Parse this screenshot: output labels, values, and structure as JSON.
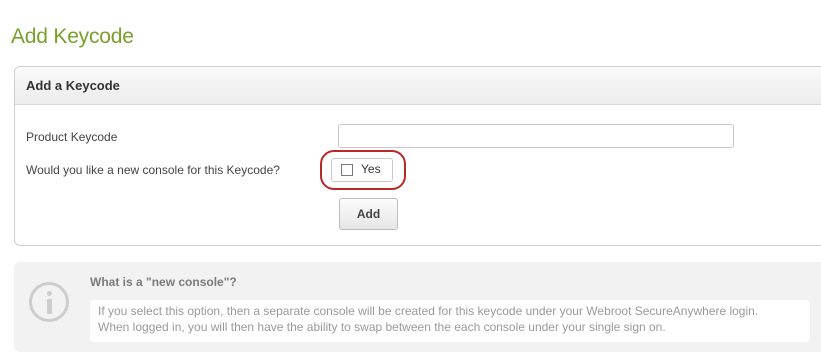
{
  "page": {
    "title": "Add Keycode"
  },
  "panel": {
    "header": "Add a Keycode",
    "product_keycode_label": "Product Keycode",
    "product_keycode_value": "",
    "new_console_question": "Would you like a new console for this Keycode?",
    "new_console_checkbox_label": "Yes",
    "new_console_checked": false,
    "add_button_label": "Add",
    "highlight_color": "#b82a2a"
  },
  "info": {
    "icon": "info-circle-icon",
    "title": "What is a \"new console\"?",
    "body_line_1": "If you select this option, then a separate console will be created for this keycode under your Webroot SecureAnywhere login.",
    "body_line_2": "When logged in, you will then have the ability to swap between the each console under your single sign on."
  },
  "colors": {
    "title_green": "#7aa02b"
  }
}
